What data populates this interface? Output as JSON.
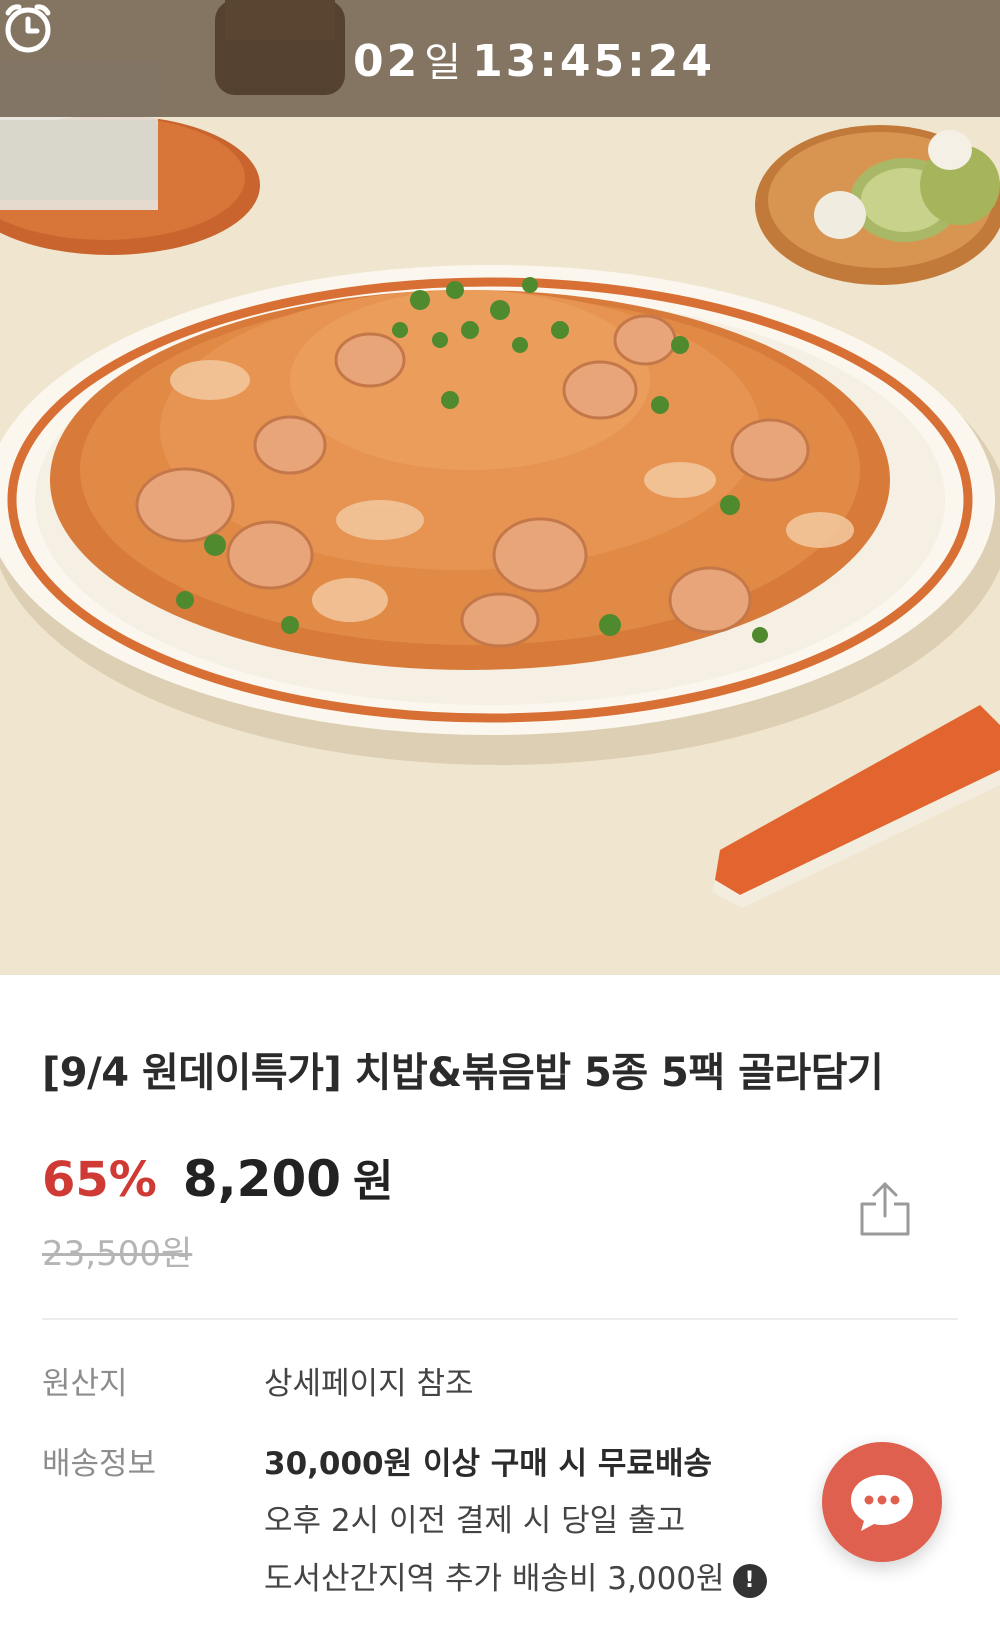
{
  "timer": {
    "days": "02",
    "day_unit": "일",
    "time": "13:45:24",
    "icon": "alarm-clock-icon"
  },
  "product": {
    "title": "[9/4 원데이특가] 치밥&볶음밥 5종 5팩 골라담기",
    "discount": "65%",
    "price": "8,200",
    "price_unit": "원",
    "original_price": "23,500원"
  },
  "details": {
    "origin_label": "원산지",
    "origin_value": "상세페이지 참조",
    "shipping_label": "배송정보",
    "shipping_line1": "30,000원 이상 구매 시 무료배송",
    "shipping_line2": "오후 2시 이전 결제 시 당일 출고",
    "shipping_line3": "도서산간지역 추가 배송비 3,000원",
    "info_glyph": "!"
  },
  "colors": {
    "discount": "#cf3b34",
    "chat_button": "#e0604f",
    "timer_bar": "#5a4a38"
  },
  "icons": {
    "share": "share-icon",
    "chat": "chat-bubble-icon",
    "info": "exclamation-circle-icon"
  }
}
